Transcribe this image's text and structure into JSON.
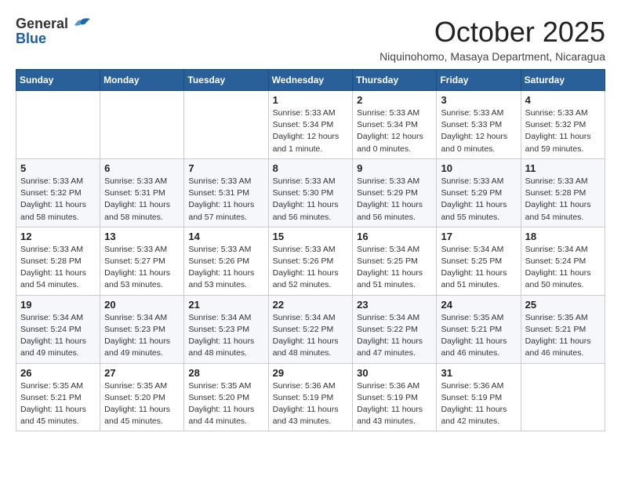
{
  "header": {
    "logo_general": "General",
    "logo_blue": "Blue",
    "month_title": "October 2025",
    "location": "Niquinohomo, Masaya Department, Nicaragua"
  },
  "days_of_week": [
    "Sunday",
    "Monday",
    "Tuesday",
    "Wednesday",
    "Thursday",
    "Friday",
    "Saturday"
  ],
  "weeks": [
    [
      {
        "day": "",
        "info": ""
      },
      {
        "day": "",
        "info": ""
      },
      {
        "day": "",
        "info": ""
      },
      {
        "day": "1",
        "info": "Sunrise: 5:33 AM\nSunset: 5:34 PM\nDaylight: 12 hours\nand 1 minute."
      },
      {
        "day": "2",
        "info": "Sunrise: 5:33 AM\nSunset: 5:34 PM\nDaylight: 12 hours\nand 0 minutes."
      },
      {
        "day": "3",
        "info": "Sunrise: 5:33 AM\nSunset: 5:33 PM\nDaylight: 12 hours\nand 0 minutes."
      },
      {
        "day": "4",
        "info": "Sunrise: 5:33 AM\nSunset: 5:32 PM\nDaylight: 11 hours\nand 59 minutes."
      }
    ],
    [
      {
        "day": "5",
        "info": "Sunrise: 5:33 AM\nSunset: 5:32 PM\nDaylight: 11 hours\nand 58 minutes."
      },
      {
        "day": "6",
        "info": "Sunrise: 5:33 AM\nSunset: 5:31 PM\nDaylight: 11 hours\nand 58 minutes."
      },
      {
        "day": "7",
        "info": "Sunrise: 5:33 AM\nSunset: 5:31 PM\nDaylight: 11 hours\nand 57 minutes."
      },
      {
        "day": "8",
        "info": "Sunrise: 5:33 AM\nSunset: 5:30 PM\nDaylight: 11 hours\nand 56 minutes."
      },
      {
        "day": "9",
        "info": "Sunrise: 5:33 AM\nSunset: 5:29 PM\nDaylight: 11 hours\nand 56 minutes."
      },
      {
        "day": "10",
        "info": "Sunrise: 5:33 AM\nSunset: 5:29 PM\nDaylight: 11 hours\nand 55 minutes."
      },
      {
        "day": "11",
        "info": "Sunrise: 5:33 AM\nSunset: 5:28 PM\nDaylight: 11 hours\nand 54 minutes."
      }
    ],
    [
      {
        "day": "12",
        "info": "Sunrise: 5:33 AM\nSunset: 5:28 PM\nDaylight: 11 hours\nand 54 minutes."
      },
      {
        "day": "13",
        "info": "Sunrise: 5:33 AM\nSunset: 5:27 PM\nDaylight: 11 hours\nand 53 minutes."
      },
      {
        "day": "14",
        "info": "Sunrise: 5:33 AM\nSunset: 5:26 PM\nDaylight: 11 hours\nand 53 minutes."
      },
      {
        "day": "15",
        "info": "Sunrise: 5:33 AM\nSunset: 5:26 PM\nDaylight: 11 hours\nand 52 minutes."
      },
      {
        "day": "16",
        "info": "Sunrise: 5:34 AM\nSunset: 5:25 PM\nDaylight: 11 hours\nand 51 minutes."
      },
      {
        "day": "17",
        "info": "Sunrise: 5:34 AM\nSunset: 5:25 PM\nDaylight: 11 hours\nand 51 minutes."
      },
      {
        "day": "18",
        "info": "Sunrise: 5:34 AM\nSunset: 5:24 PM\nDaylight: 11 hours\nand 50 minutes."
      }
    ],
    [
      {
        "day": "19",
        "info": "Sunrise: 5:34 AM\nSunset: 5:24 PM\nDaylight: 11 hours\nand 49 minutes."
      },
      {
        "day": "20",
        "info": "Sunrise: 5:34 AM\nSunset: 5:23 PM\nDaylight: 11 hours\nand 49 minutes."
      },
      {
        "day": "21",
        "info": "Sunrise: 5:34 AM\nSunset: 5:23 PM\nDaylight: 11 hours\nand 48 minutes."
      },
      {
        "day": "22",
        "info": "Sunrise: 5:34 AM\nSunset: 5:22 PM\nDaylight: 11 hours\nand 48 minutes."
      },
      {
        "day": "23",
        "info": "Sunrise: 5:34 AM\nSunset: 5:22 PM\nDaylight: 11 hours\nand 47 minutes."
      },
      {
        "day": "24",
        "info": "Sunrise: 5:35 AM\nSunset: 5:21 PM\nDaylight: 11 hours\nand 46 minutes."
      },
      {
        "day": "25",
        "info": "Sunrise: 5:35 AM\nSunset: 5:21 PM\nDaylight: 11 hours\nand 46 minutes."
      }
    ],
    [
      {
        "day": "26",
        "info": "Sunrise: 5:35 AM\nSunset: 5:21 PM\nDaylight: 11 hours\nand 45 minutes."
      },
      {
        "day": "27",
        "info": "Sunrise: 5:35 AM\nSunset: 5:20 PM\nDaylight: 11 hours\nand 45 minutes."
      },
      {
        "day": "28",
        "info": "Sunrise: 5:35 AM\nSunset: 5:20 PM\nDaylight: 11 hours\nand 44 minutes."
      },
      {
        "day": "29",
        "info": "Sunrise: 5:36 AM\nSunset: 5:19 PM\nDaylight: 11 hours\nand 43 minutes."
      },
      {
        "day": "30",
        "info": "Sunrise: 5:36 AM\nSunset: 5:19 PM\nDaylight: 11 hours\nand 43 minutes."
      },
      {
        "day": "31",
        "info": "Sunrise: 5:36 AM\nSunset: 5:19 PM\nDaylight: 11 hours\nand 42 minutes."
      },
      {
        "day": "",
        "info": ""
      }
    ]
  ]
}
